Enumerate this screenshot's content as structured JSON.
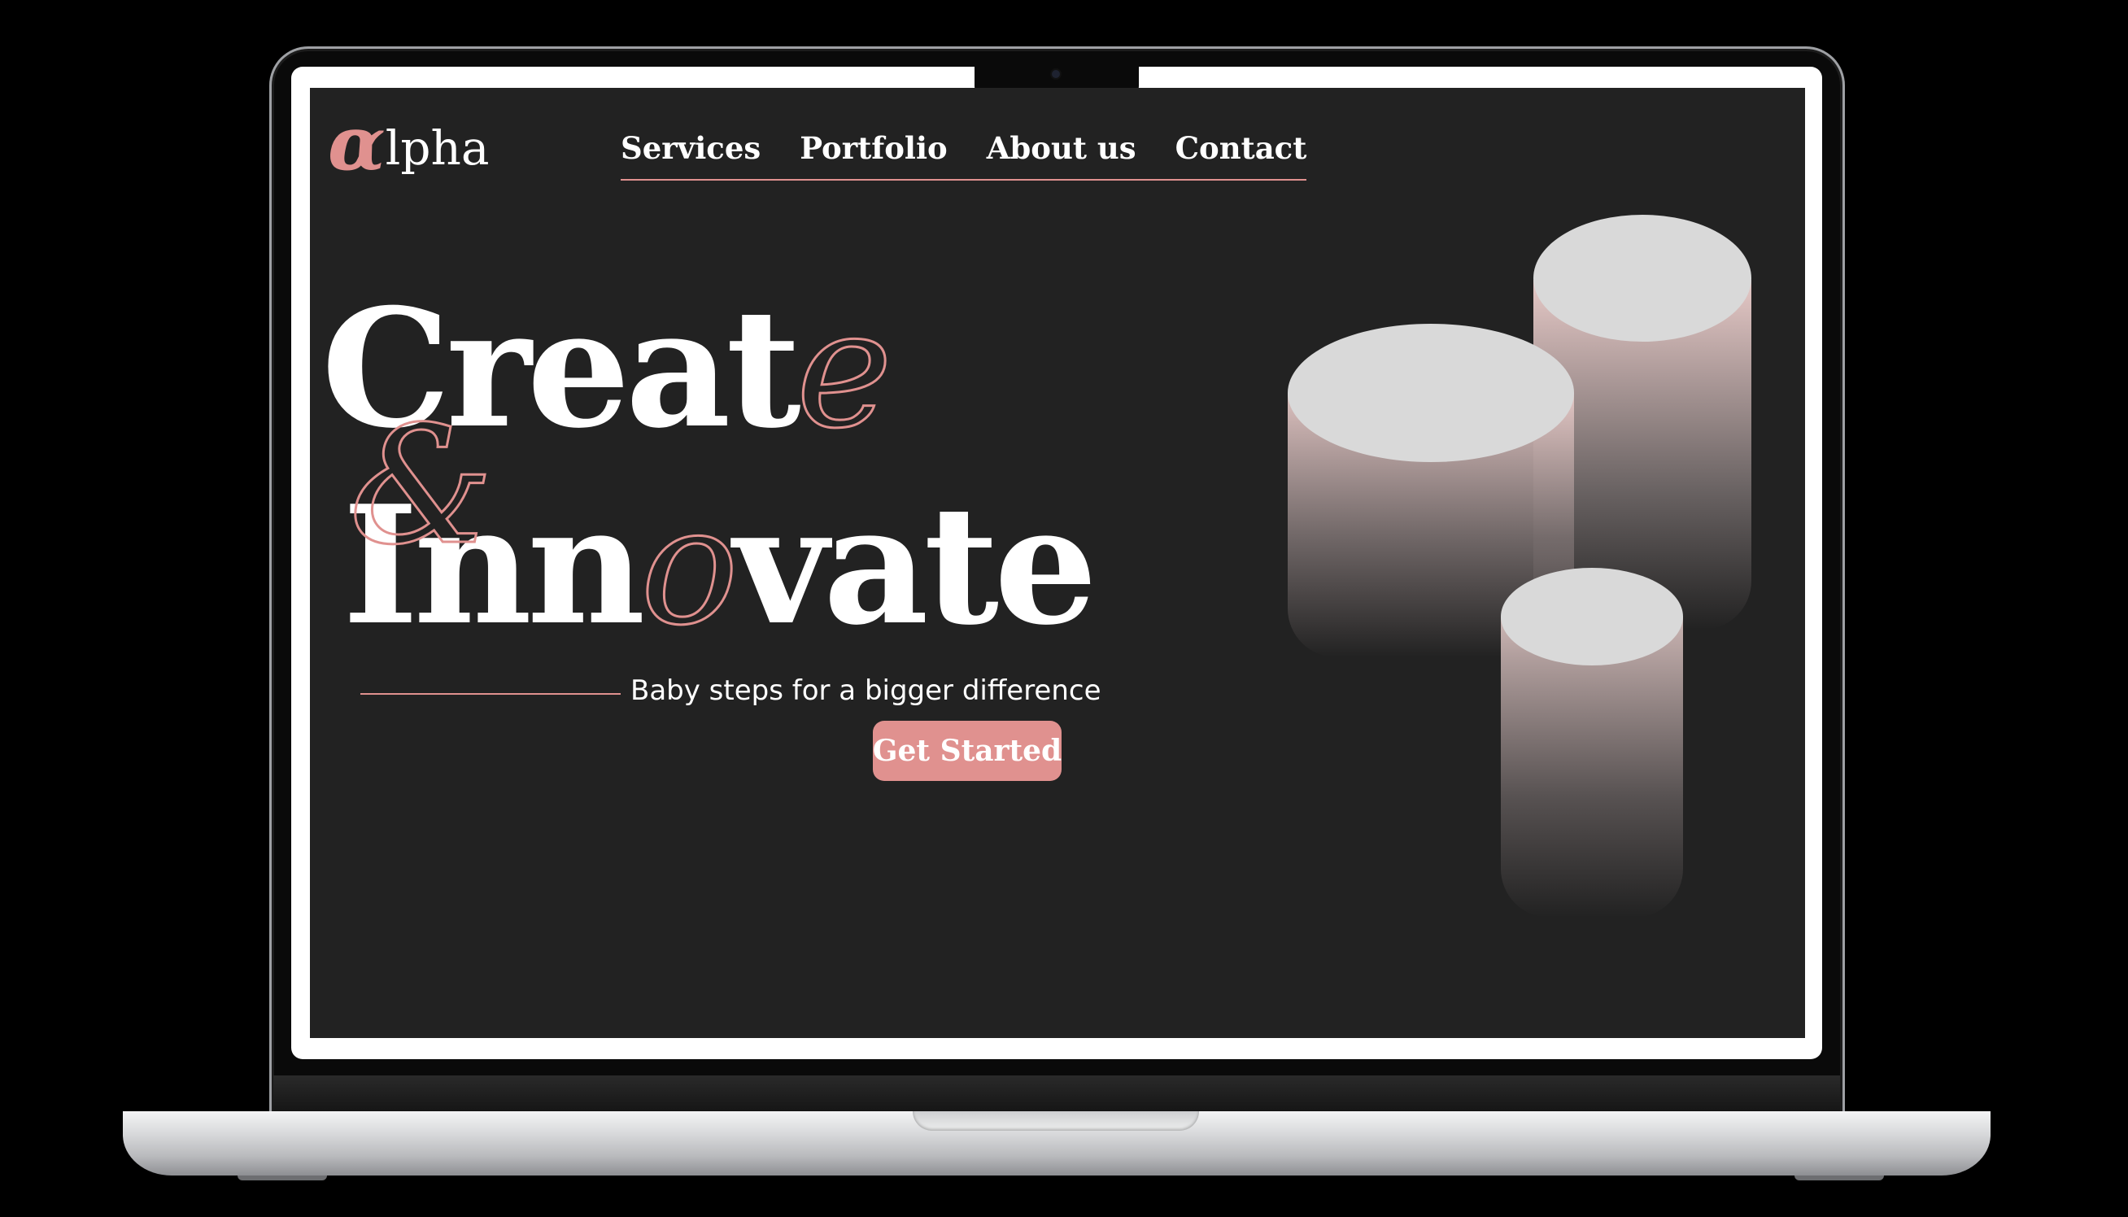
{
  "logo": {
    "glyph": "α",
    "text": "lpha"
  },
  "nav": [
    "Services",
    "Portfolio",
    "About us",
    "Contact"
  ],
  "hero": {
    "line1_main": "Creat",
    "line1_outline": "e",
    "ampersand": "&",
    "line2_start": "Inn",
    "line2_outline": "o",
    "line2_end": "vate",
    "tagline": "Baby steps for a bigger difference",
    "cta": "Get Started"
  },
  "colors": {
    "accent": "#e0918f",
    "background": "#222222",
    "text": "#ffffff"
  }
}
